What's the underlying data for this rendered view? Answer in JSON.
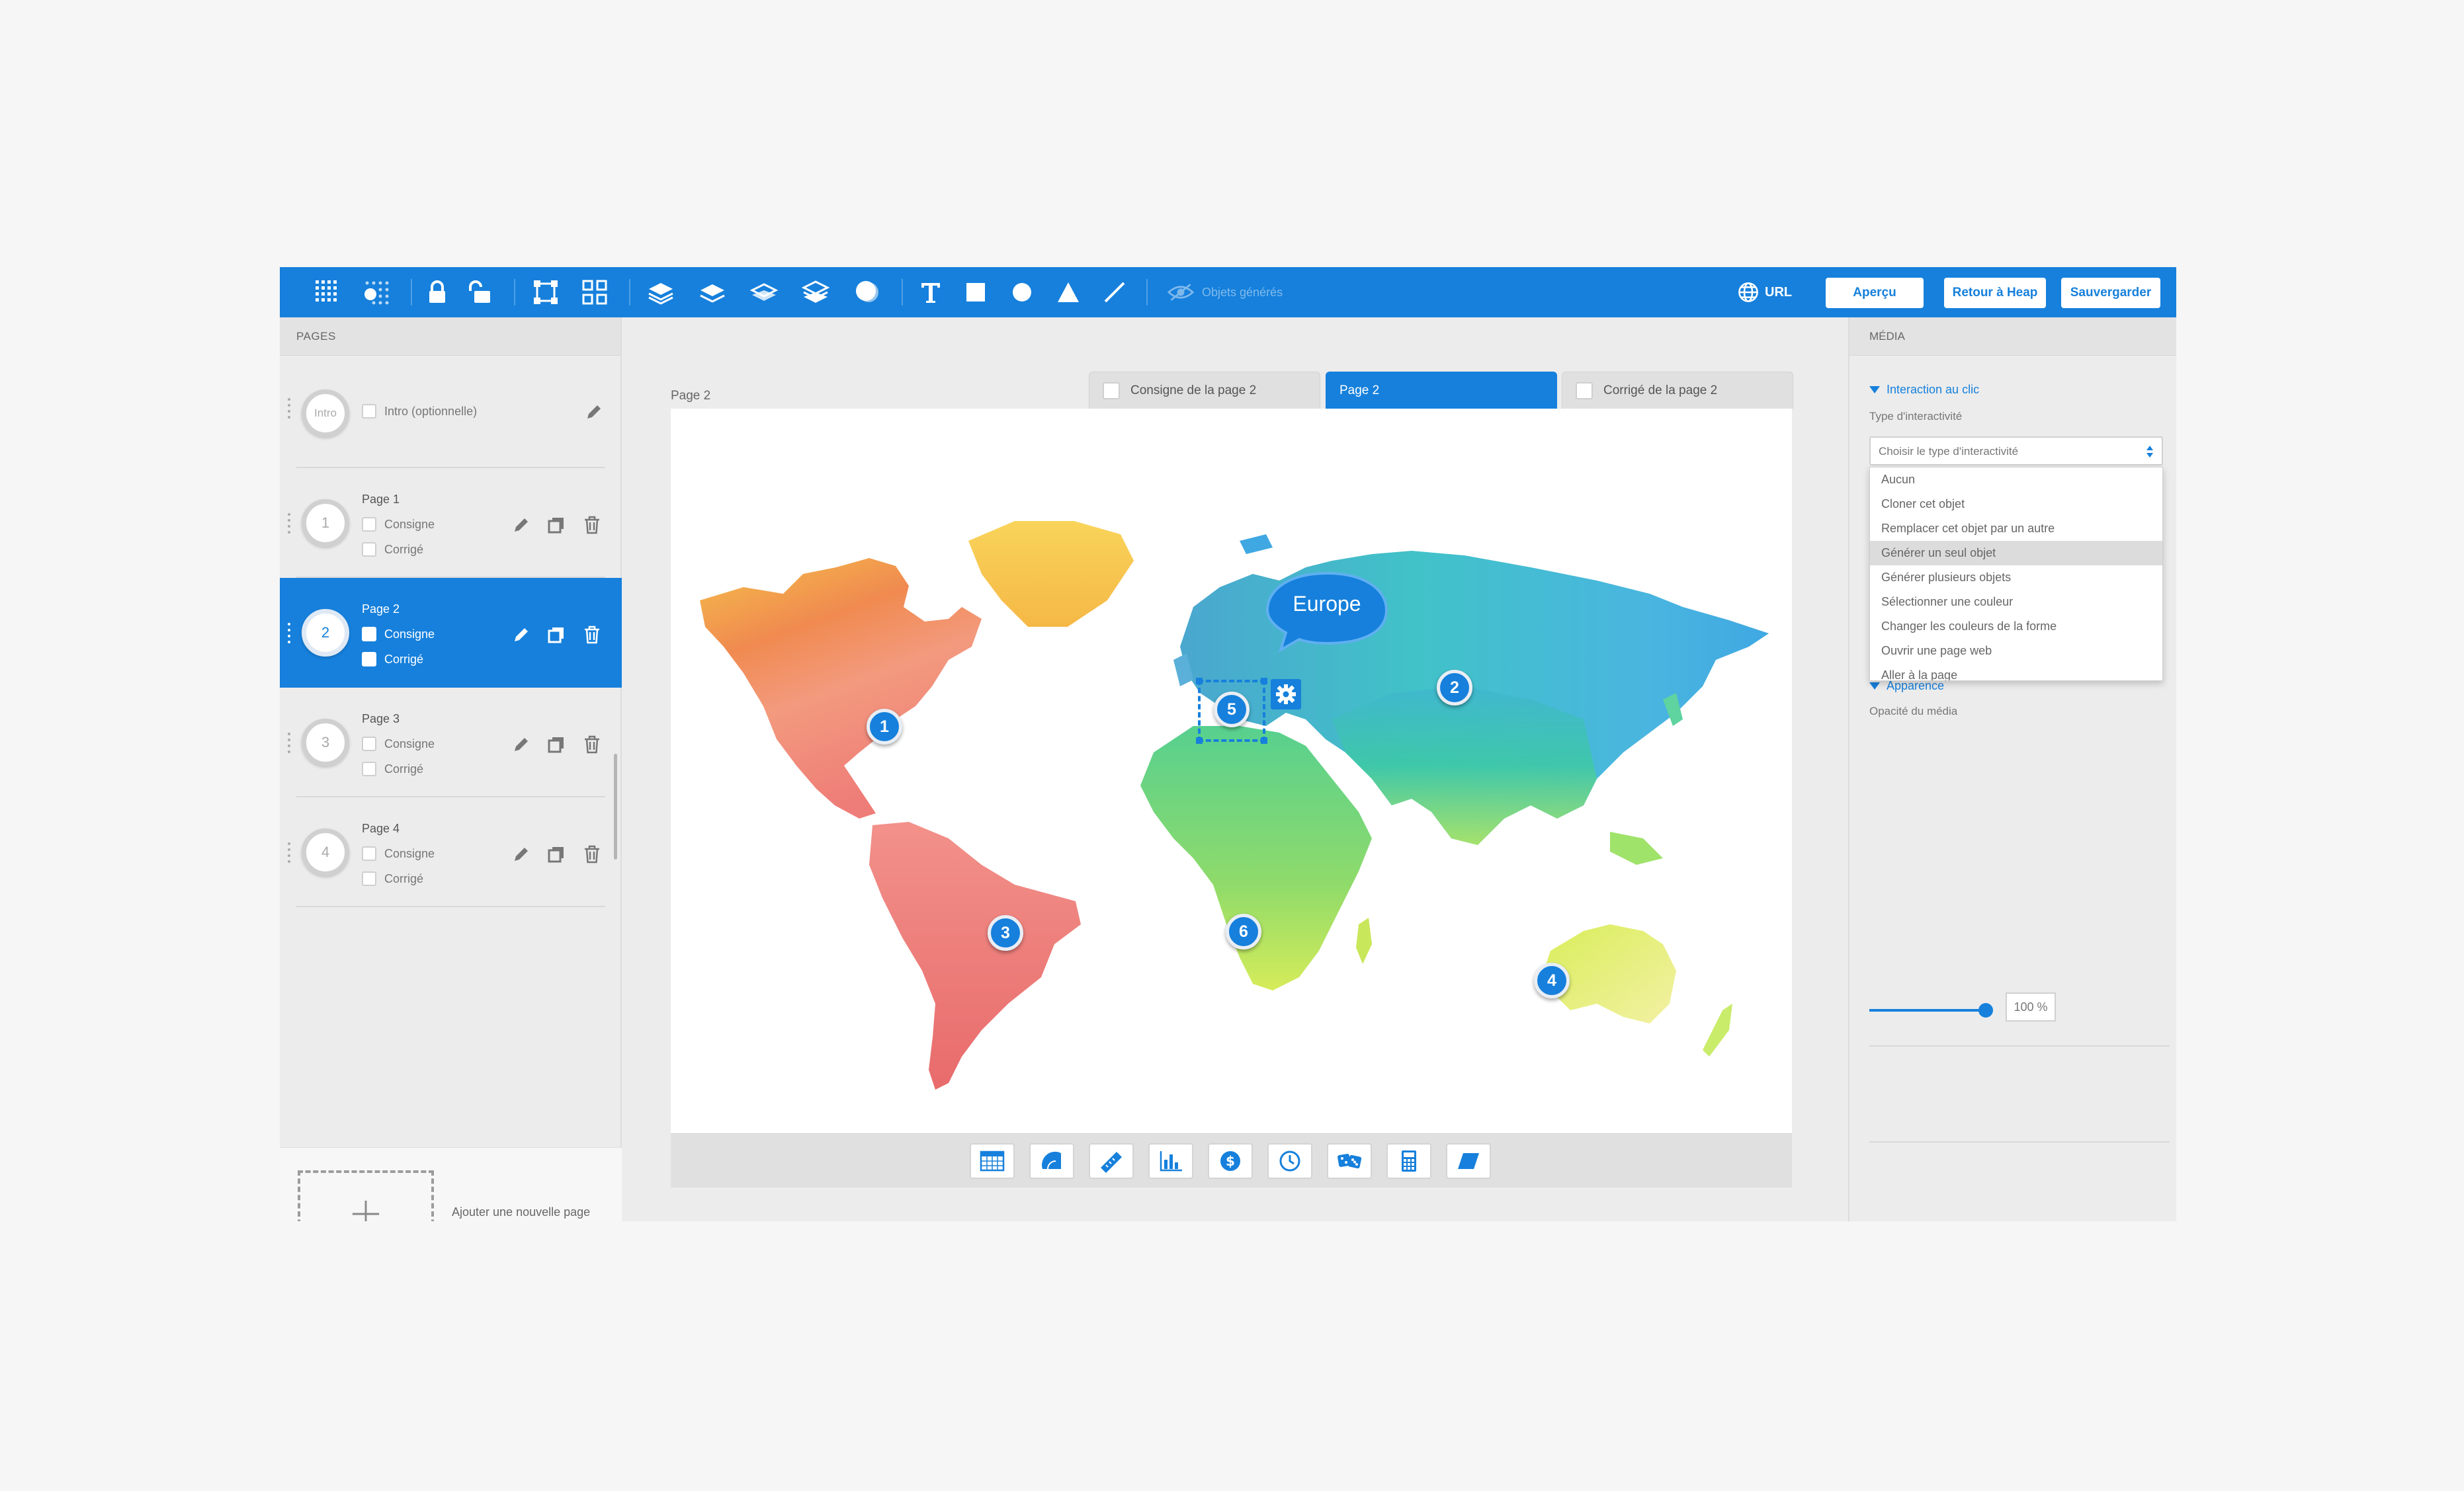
{
  "toolbar": {
    "generated_objects_label": "Objets générés",
    "url_label": "URL",
    "preview_label": "Aperçu",
    "back_label": "Retour à Heap",
    "save_label": "Sauvergarder"
  },
  "left_panel": {
    "title": "PAGES",
    "intro": {
      "circle": "Intro",
      "label": "Intro (optionnelle)"
    },
    "pages": [
      {
        "number": "1",
        "title": "Page 1",
        "consigne": "Consigne",
        "corrige": "Corrigé",
        "active": false
      },
      {
        "number": "2",
        "title": "Page 2",
        "consigne": "Consigne",
        "corrige": "Corrigé",
        "active": true
      },
      {
        "number": "3",
        "title": "Page 3",
        "consigne": "Consigne",
        "corrige": "Corrigé",
        "active": false
      },
      {
        "number": "4",
        "title": "Page 4",
        "consigne": "Consigne",
        "corrige": "Corrigé",
        "active": false
      }
    ],
    "add_page_label": "Ajouter une nouvelle page"
  },
  "center": {
    "page_label": "Page 2",
    "tabs": [
      {
        "label": "Consigne de la page 2",
        "active": false
      },
      {
        "label": "Page 2",
        "active": true
      },
      {
        "label": "Corrigé de la page 2",
        "active": false
      }
    ],
    "bubble_label": "Europe",
    "markers": [
      "1",
      "2",
      "3",
      "4",
      "5",
      "6"
    ],
    "tools": [
      "table-icon",
      "protractor-icon",
      "ruler-icon",
      "bar-chart-icon",
      "dollar-icon",
      "clock-icon",
      "dice-icon",
      "calculator-icon",
      "parallelogram-icon"
    ]
  },
  "right_panel": {
    "title": "MÉDIA",
    "interaction_section": "Interaction au clic",
    "interactivity_label": "Type d'interactivité",
    "select_placeholder": "Choisir le type d'interactivité",
    "options": [
      "Aucun",
      "Cloner cet objet",
      "Remplacer cet objet par un autre",
      "Générer un seul objet",
      "Générer plusieurs objets",
      "Sélectionner une couleur",
      "Changer les couleurs de la forme",
      "Ouvrir une page web",
      "Aller à la page"
    ],
    "highlighted_option_index": 3,
    "appearance_section": "Apparence",
    "opacity_label": "Opacité du média",
    "opacity_value": "100 %",
    "opacity_fraction": 1.0
  },
  "colors": {
    "accent": "#1680dc",
    "panel_bg": "#ececec",
    "page_bg": "#f6f6f6"
  }
}
